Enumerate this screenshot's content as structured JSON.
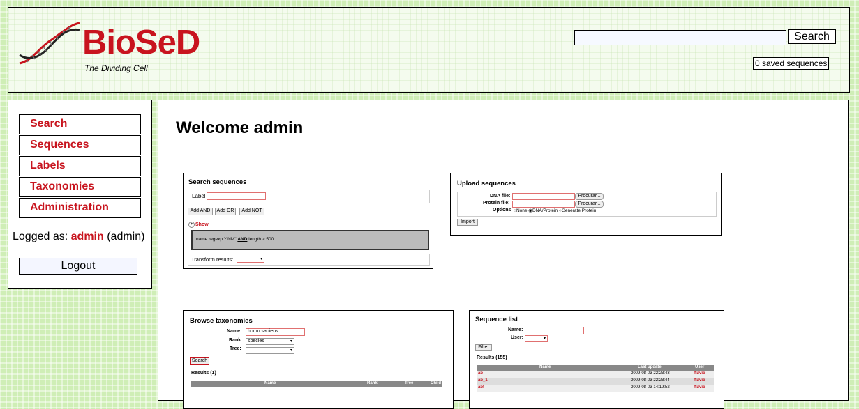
{
  "header": {
    "logo_text": "BioSeD",
    "tagline": "The Dividing Cell",
    "search_button": "Search",
    "search_value": "",
    "saved_sequences": "0 saved sequences"
  },
  "sidebar": {
    "items": [
      {
        "label": "Search"
      },
      {
        "label": "Sequences"
      },
      {
        "label": "Labels"
      },
      {
        "label": "Taxonomies"
      },
      {
        "label": "Administration"
      }
    ],
    "logged_prefix": "Logged as:",
    "logged_user": "admin",
    "logged_role": "(admin)",
    "logout": "Logout"
  },
  "main": {
    "welcome": "Welcome admin",
    "search_panel": {
      "title": "Search sequences",
      "label_field": "Label",
      "add_and": "Add AND",
      "add_or": "Add OR",
      "add_not": "Add NOT",
      "show": "Show",
      "query_pre": "name regexp \"^NM\"",
      "query_and": "AND",
      "query_post": "length > 500",
      "transform": "Transform results:"
    },
    "upload_panel": {
      "title": "Upload sequences",
      "dna_label": "DNA file:",
      "protein_label": "Protein file:",
      "browse": "Procurar...",
      "options_label": "Options",
      "opt_none": "None",
      "opt_dna": "DNA/Protein",
      "opt_gen": "Generate Protein",
      "import": "Import"
    },
    "taxonomy_panel": {
      "title": "Browse taxonomies",
      "name_label": "Name:",
      "name_value": "homo sapiens",
      "rank_label": "Rank:",
      "rank_value": "species",
      "tree_label": "Tree:",
      "search": "Search",
      "results": "Results (1)",
      "columns": [
        "Name",
        "Rank",
        "Tree",
        "Child"
      ]
    },
    "seqlist_panel": {
      "title": "Sequence list",
      "name_label": "Name:",
      "user_label": "User:",
      "filter": "Filter",
      "results": "Results (155)",
      "columns": [
        "Name",
        "Last update",
        "User"
      ],
      "rows": [
        {
          "name": "ab",
          "updated": "2009-08-03 22:23:43",
          "user": "flavio"
        },
        {
          "name": "ab_1",
          "updated": "2009-08-03 22:23:44",
          "user": "flavio"
        },
        {
          "name": "abf",
          "updated": "2009-08-03 14:19:52",
          "user": "flavio"
        }
      ]
    }
  }
}
